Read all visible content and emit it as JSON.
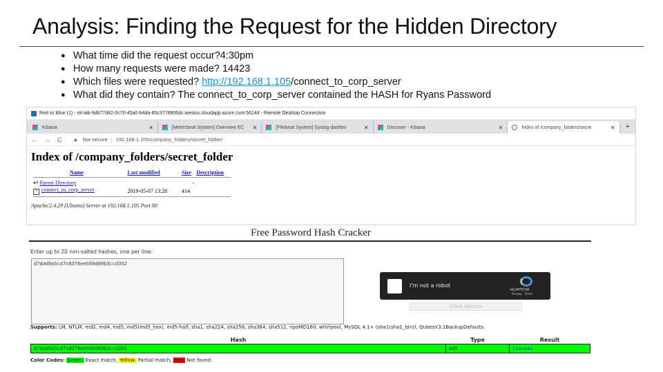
{
  "slide": {
    "title": "Analysis: Finding the Request for the Hidden Directory",
    "bullets": [
      {
        "text": "What time did the request occur?4:30pm"
      },
      {
        "text": "How many requests were made? 14423"
      },
      {
        "prefix": "Which files were requested?  ",
        "link": "http://192.168.1.105",
        "suffix": "/connect_to_corp_server"
      },
      {
        "text": "What did they contain? The connect_to_corp_server contained the HASH for Ryans Password"
      }
    ]
  },
  "remote_desktop": {
    "title": "Red vs Blue (1) - ml-lab-9db77d42-0c70-45a0-b4da-85c3778906dc.westus.cloudapp.azure.com:56144 - Remote Desktop Connection",
    "tabs": [
      {
        "label": "Kibana",
        "icon": "kibana-icon",
        "active": false
      },
      {
        "label": "[Metricbeat System] Overview EC",
        "icon": "kibana-icon",
        "active": false
      },
      {
        "label": "[Filebeat System] Syslog dashbo",
        "icon": "kibana-icon",
        "active": false
      },
      {
        "label": "Discover - Kibana",
        "icon": "kibana-icon",
        "active": false
      },
      {
        "label": "Index of /company_folders/secre",
        "icon": "globe-icon",
        "active": true
      }
    ],
    "new_tab_label": "+",
    "address": {
      "security_label": "Not secure",
      "url": "192.168.1.105/company_folders/secret_folder/"
    },
    "page": {
      "heading": "Index of /company_folders/secret_folder",
      "columns": [
        "Name",
        "Last modified",
        "Size",
        "Description"
      ],
      "parent_link": "Parent Directory",
      "parent_size": "-",
      "file": {
        "name": "connect_to_corp_server",
        "modified": "2019-05-07 13:28",
        "size": "414"
      },
      "footer": "Apache/2.4.29 (Ubuntu) Server at 192.168.1.105 Port 80"
    }
  },
  "hash_cracker": {
    "title": "Free Password Hash Cracker",
    "instructions": "Enter up to 20 non-salted hashes, one per line:",
    "input_value": "d7dad0a5cd7c8376eeb50d69b3ccd352",
    "captcha": {
      "label": "I'm not a robot",
      "brand": "reCAPTCHA",
      "terms": "Privacy - Terms"
    },
    "crack_button": "Crack Hashes",
    "supports_label": "Supports:",
    "supports_text": " LM, NTLM, md2, md4, md5, md5(md5_hex), md5-half, sha1, sha224, sha256, sha384, sha512, ripeMD160, whirlpool, MySQL 4.1+ (sha1(sha1_bin)), QubesV3.1BackupDefaults",
    "result_headers": [
      "Hash",
      "Type",
      "Result"
    ],
    "result_row": {
      "hash": "d7dad0a5cd7c8376eeb50d69b3ccd352",
      "type": "md5",
      "result": "linux4u"
    },
    "color_codes": {
      "label": "Color Codes:",
      "green": "Green:",
      "green_desc": " Exact match, ",
      "yellow": "Yellow:",
      "yellow_desc": " Partial match, ",
      "red": "Red:",
      "red_desc": " Not found."
    },
    "colors": {
      "match": "#00ff00",
      "partial": "#ffff00",
      "not_found": "#ff0000"
    }
  }
}
